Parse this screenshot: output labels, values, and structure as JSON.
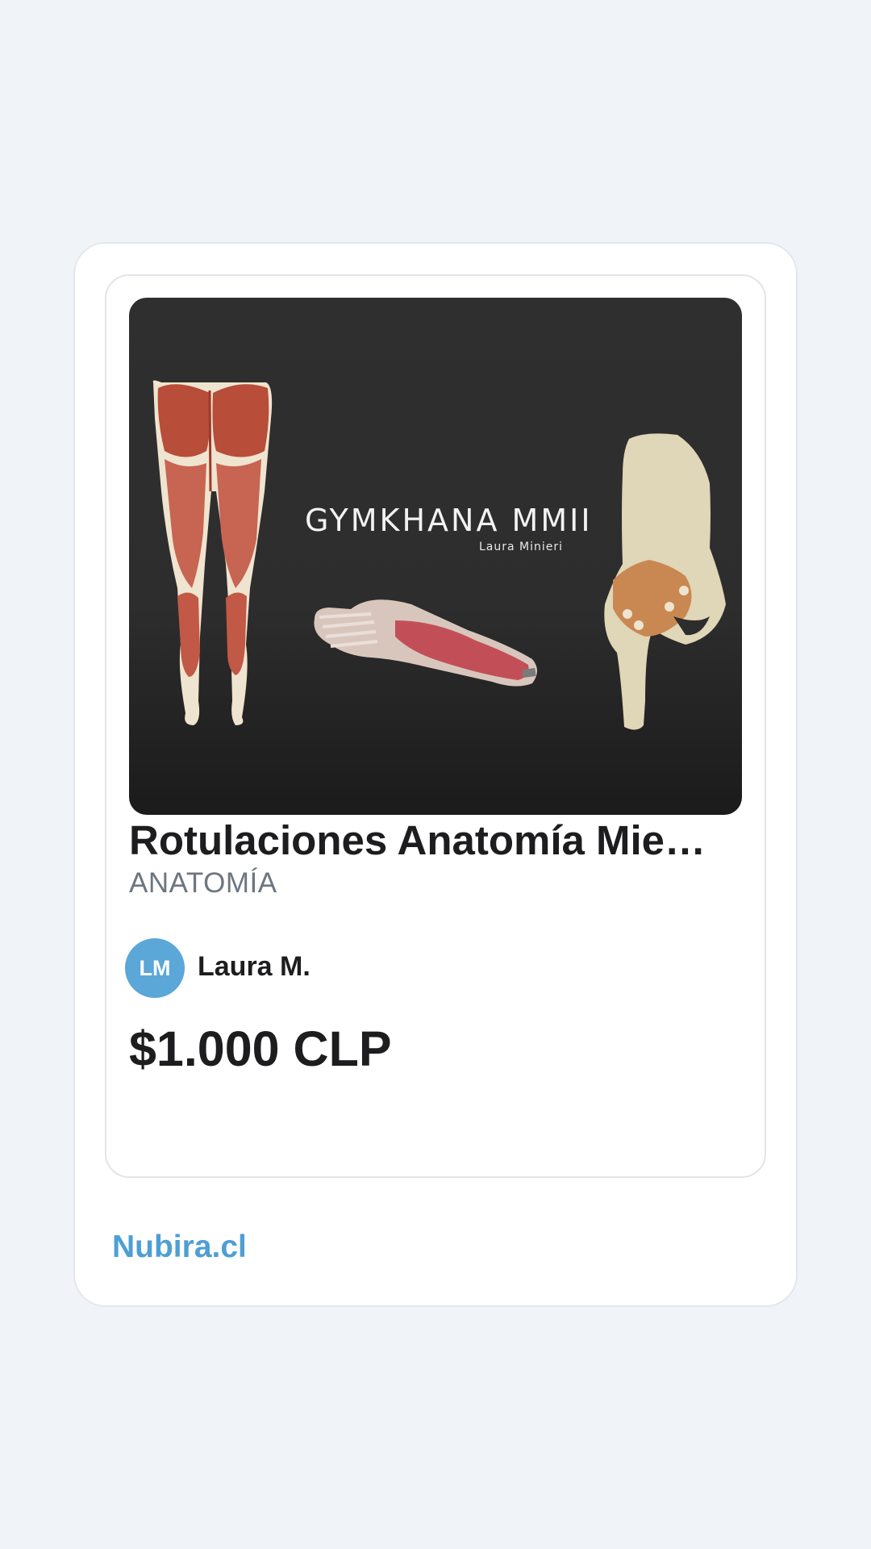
{
  "card": {
    "cover": {
      "title": "GYMKHANA MMII",
      "author": "Laura Minieri"
    },
    "title": "Rotulaciones Anatomía Miembro Inferior",
    "category": "ANATOMÍA",
    "seller": {
      "initials": "LM",
      "name": "Laura M."
    },
    "price": "$1.000 CLP"
  },
  "footer": {
    "brand": "Nubira.cl"
  },
  "colors": {
    "page_background": "#f0f4f8",
    "accent": "#4e9fd3",
    "avatar": "#5aa7d8",
    "text": "#1d1d1f",
    "muted": "#6e7682"
  }
}
